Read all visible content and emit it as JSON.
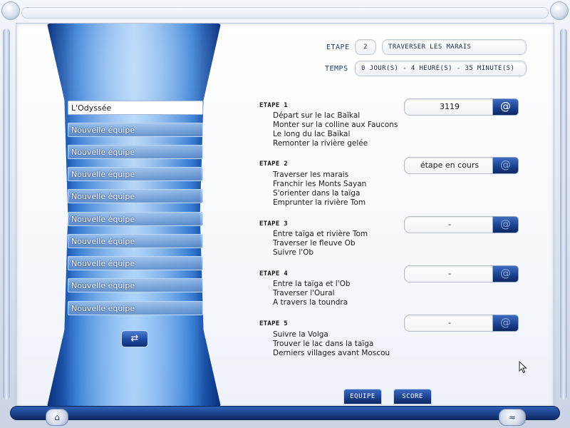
{
  "header": {
    "stage_label": "ETAPE",
    "stage_number": "2",
    "stage_name": "TRAVERSER LES MARAIS",
    "time_label": "TEMPS",
    "time_value": "0 JOUR(S) - 4 HEURE(S) - 35 MINUTE(S)"
  },
  "teams": [
    "L'Odyssée",
    "Nouvelle équipe",
    "Nouvelle équipe",
    "Nouvelle équipe",
    "Nouvelle équipe",
    "Nouvelle équipe",
    "Nouvelle équipe",
    "Nouvelle équipe",
    "Nouvelle équipe",
    "Nouvelle équipe"
  ],
  "stages": [
    {
      "title": "ETAPE 1",
      "lines": [
        "Départ sur le lac Baïkal",
        "Monter sur la colline aux Faucons",
        "Le long du lac Baïkal",
        "Remonter  la rivière gelée"
      ],
      "result": "3119"
    },
    {
      "title": "ETAPE 2",
      "lines": [
        "Traverser les marais",
        "Franchir les Monts Sayan",
        "S'orienter dans la taïga",
        "Emprunter la rivière Tom"
      ],
      "result": "étape en cours"
    },
    {
      "title": "ETAPE 3",
      "lines": [
        "Entre taïga et rivière Tom",
        "Traverser le fleuve Ob",
        "Suivre l'Ob"
      ],
      "result": "-"
    },
    {
      "title": "ETAPE 4",
      "lines": [
        "Entre la taïga et l'Ob",
        "Traverser l'Oural",
        "A travers la toundra"
      ],
      "result": "-"
    },
    {
      "title": "ETAPE 5",
      "lines": [
        "Suivre la Volga",
        "Trouver le lac dans la taïga",
        "Derniers villages avant Moscou"
      ],
      "result": "-"
    }
  ],
  "buttons": {
    "at_symbol": "@",
    "team_tab": "EQUIPE",
    "score_tab": "SCORE",
    "swap_icon": "⇄",
    "home_icon": "⌂",
    "snail_icon": "≈"
  }
}
